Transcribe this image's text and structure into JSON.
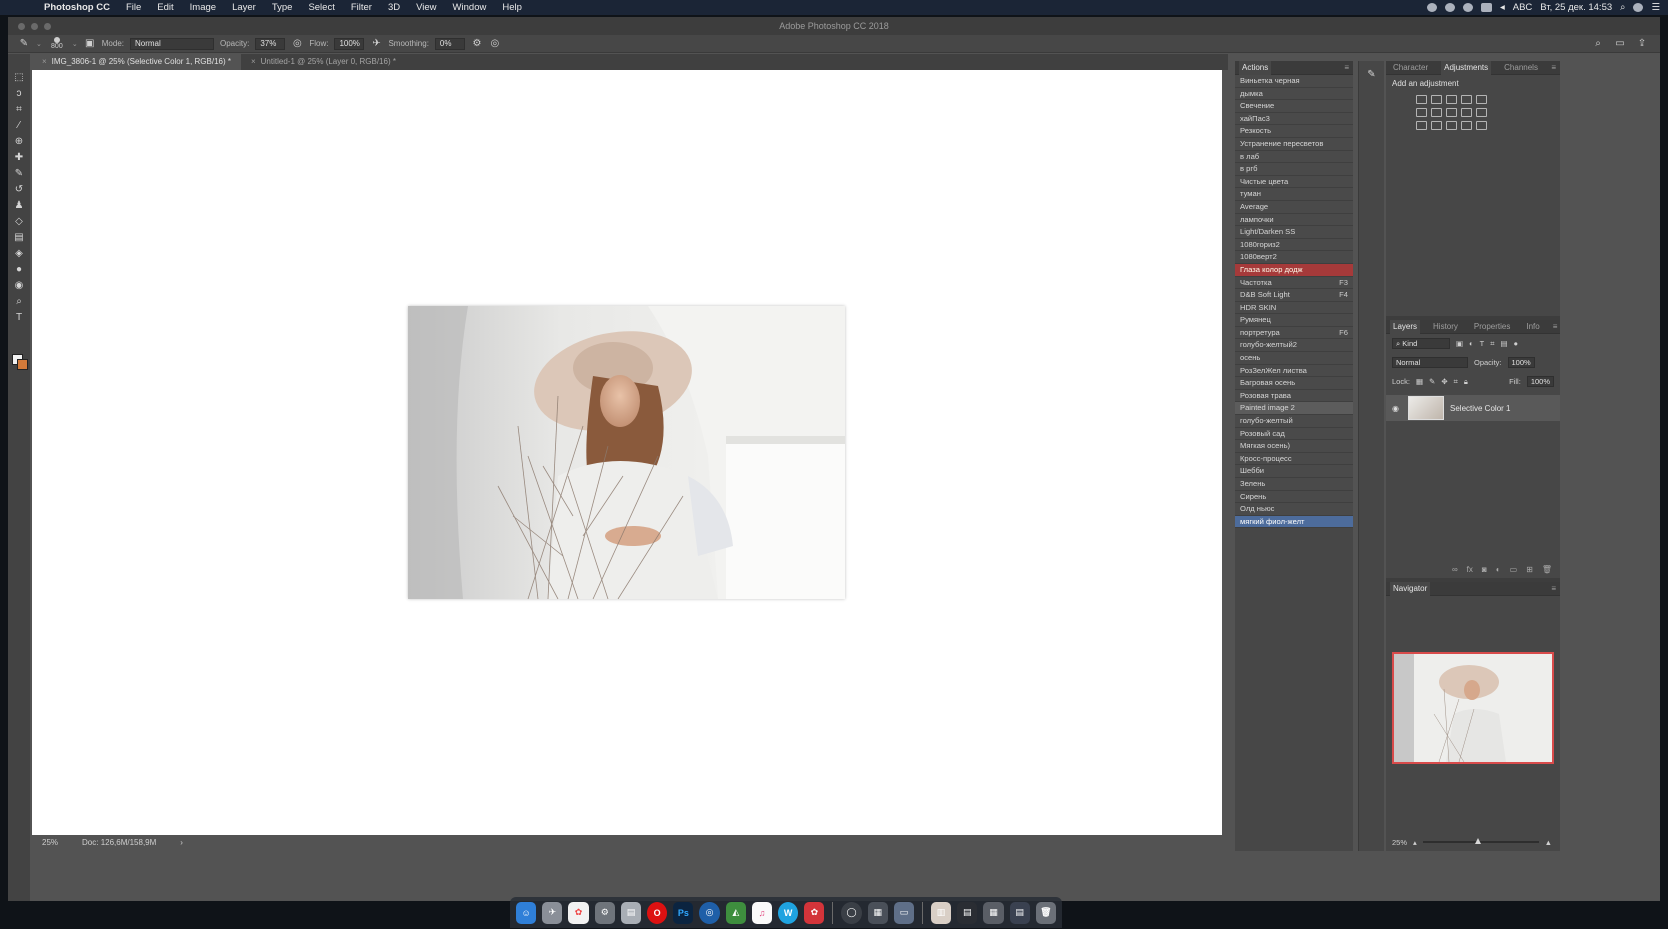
{
  "menubar": {
    "app_name": "Photoshop CC",
    "items": [
      "File",
      "Edit",
      "Image",
      "Layer",
      "Type",
      "Select",
      "Filter",
      "3D",
      "View",
      "Window",
      "Help"
    ],
    "keyboard": "ABC",
    "datetime": "Вт, 25 дек. 14:53"
  },
  "window": {
    "title": "Adobe Photoshop CC 2018"
  },
  "options": {
    "brush_size": "800",
    "mode_label": "Mode:",
    "mode_value": "Normal",
    "opacity_label": "Opacity:",
    "opacity_value": "37%",
    "flow_label": "Flow:",
    "flow_value": "100%",
    "smoothing_label": "Smoothing:",
    "smoothing_value": "0%"
  },
  "tabs": [
    {
      "label": "IMG_3806-1 @ 25% (Selective Color 1, RGB/16) *"
    },
    {
      "label": "Untitled-1 @ 25% (Layer 0, RGB/16) *"
    }
  ],
  "status": {
    "zoom": "25%",
    "doc": "Doc: 126,6M/158,9M"
  },
  "actions_panel": {
    "title": "Actions",
    "items": [
      {
        "label": "Виньетка черная",
        "key": ""
      },
      {
        "label": "дымка",
        "key": ""
      },
      {
        "label": "Свечение",
        "key": ""
      },
      {
        "label": "хайПас3",
        "key": ""
      },
      {
        "label": "Резкость",
        "key": ""
      },
      {
        "label": "Устранение пересветов",
        "key": ""
      },
      {
        "label": "в лаб",
        "key": ""
      },
      {
        "label": "в ргб",
        "key": ""
      },
      {
        "label": "Чистые цвета",
        "key": ""
      },
      {
        "label": "туман",
        "key": ""
      },
      {
        "label": "Average",
        "key": ""
      },
      {
        "label": "лампочки",
        "key": ""
      },
      {
        "label": "Light/Darken SS",
        "key": ""
      },
      {
        "label": "1080гориз2",
        "key": ""
      },
      {
        "label": "1080верт2",
        "key": ""
      },
      {
        "label": "Глаза колор додж",
        "key": ""
      },
      {
        "label": "Частотка",
        "key": "F3"
      },
      {
        "label": "D&B Soft Light",
        "key": "F4"
      },
      {
        "label": "HDR SKIN",
        "key": ""
      },
      {
        "label": "Румянец",
        "key": ""
      },
      {
        "label": "портретура",
        "key": "F6"
      },
      {
        "label": "голубо-желтый2",
        "key": ""
      },
      {
        "label": "осень",
        "key": ""
      },
      {
        "label": "РозЗелЖел листва",
        "key": ""
      },
      {
        "label": "Багровая осень",
        "key": ""
      },
      {
        "label": "Розовая трава",
        "key": ""
      },
      {
        "label": "Painted image 2",
        "key": ""
      },
      {
        "label": "голубо-желтый",
        "key": ""
      },
      {
        "label": "Розовый сад",
        "key": ""
      },
      {
        "label": "Мягкая осень)",
        "key": ""
      },
      {
        "label": "Кросс-процесс",
        "key": ""
      },
      {
        "label": "Шебби",
        "key": ""
      },
      {
        "label": "Зелень",
        "key": ""
      },
      {
        "label": "Сирень",
        "key": ""
      },
      {
        "label": "Олд ньюс",
        "key": ""
      },
      {
        "label": "мягкий фиол-желт",
        "key": ""
      }
    ]
  },
  "adjustments_panel": {
    "tabs": [
      "Character",
      "Adjustments",
      "Channels"
    ],
    "hint": "Add an adjustment"
  },
  "layers_panel": {
    "tabs": [
      "Layers",
      "History",
      "Properties",
      "Info"
    ],
    "kind": "Kind",
    "blend": "Normal",
    "opacity_label": "Opacity:",
    "opacity_value": "100%",
    "lock_label": "Lock:",
    "fill_label": "Fill:",
    "fill_value": "100%",
    "layer_name": "Selective Color 1"
  },
  "navigator_panel": {
    "title": "Navigator",
    "zoom": "25%"
  },
  "colors": {
    "selected_action": "#a63a3a",
    "recorded_action": "#4d6c9c",
    "foreground": "#f2f2f2",
    "background": "#d27a3a"
  }
}
